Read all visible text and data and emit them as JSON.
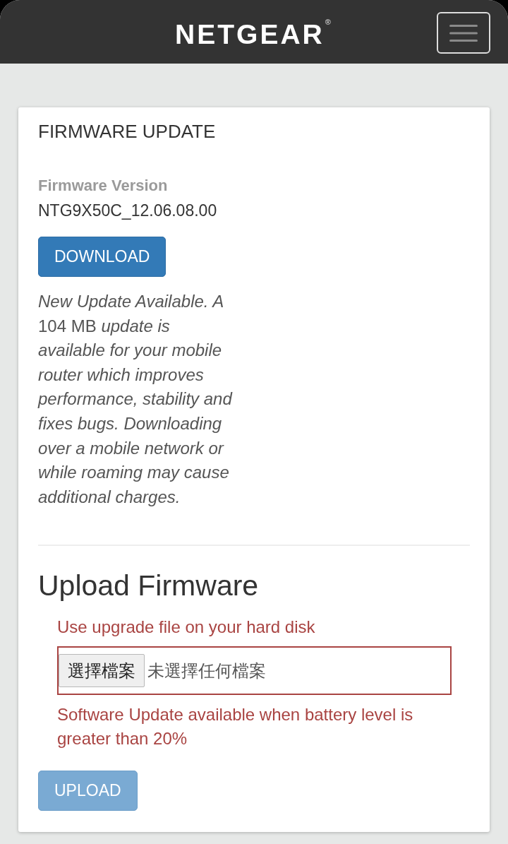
{
  "header": {
    "logo": "NETGEAR$^{®}$"
  },
  "card": {
    "title": "FIRMWARE UPDATE",
    "firmware_version": {
      "label": "Firmware Version",
      "value": "NTG9X50C_12.06.08.00"
    },
    "download_button": {
      "label": "DOWNLOAD",
      "disabled": false
    },
    "notice": "*New Update Available. A* 104 MB *update is available for your mobile router which improves performance, stability and fixes bugs. Downloading over a mobile network or while roaming may cause additional charges.*"
  },
  "upload": {
    "title": "Upload Firmware",
    "hint": "Use upgrade file on your hard disk",
    "file_input": {
      "button": "選擇檔案",
      "value": "未選擇任何檔案"
    },
    "warning": "Software Update available when battery level is greater than 20%",
    "upload_button": {
      "label": "UPLOAD",
      "disabled": true
    }
  }
}
